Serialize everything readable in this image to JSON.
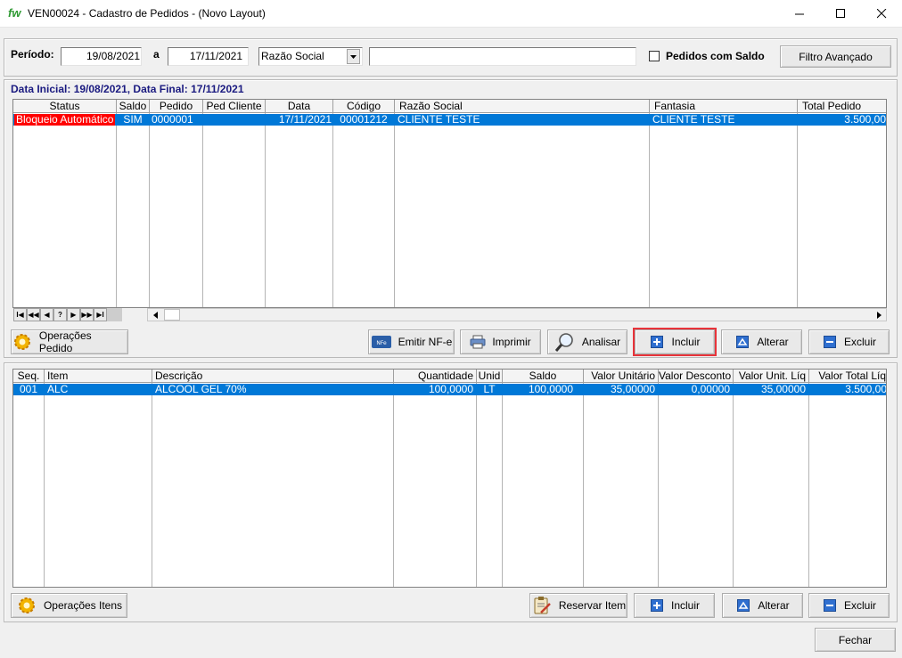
{
  "window": {
    "app_glyph": "fw",
    "title": "VEN00024 - Cadastro de Pedidos - (Novo Layout)",
    "minimize": "–",
    "maximize": "☐",
    "close": "✕"
  },
  "filter": {
    "periodo_label": "Período:",
    "date_start": "19/08/2021",
    "a_label": "a",
    "date_end": "17/11/2021",
    "field_select": "Razão Social",
    "search_value": "",
    "pedidos_saldo_label": "Pedidos com Saldo",
    "filtro_avancado": "Filtro Avançado"
  },
  "summary": "Data Inicial: 19/08/2021, Data Final: 17/11/2021",
  "orders_grid": {
    "columns": [
      "Status",
      "Saldo",
      "Pedido",
      "Ped Cliente",
      "Data",
      "Código",
      "Razão Social",
      "Fantasia",
      "Total Pedido"
    ],
    "rows": [
      [
        "Bloqueio Automático",
        "SIM",
        "0000001",
        "",
        "17/11/2021",
        "00001212",
        "CLIENTE TESTE",
        "CLIENTE TESTE",
        "3.500,00"
      ]
    ],
    "status_color": "#ff0000",
    "nav": [
      "I◀",
      "◀◀",
      "◀",
      "?",
      "▶",
      "▶▶",
      "▶I"
    ]
  },
  "order_actions": {
    "operacoes": "Operações Pedido",
    "emitir_nfe": "Emitir NF-e",
    "nfe_badge": "NFe",
    "imprimir": "Imprimir",
    "analisar": "Analisar",
    "incluir": "Incluir",
    "alterar": "Alterar",
    "excluir": "Excluir"
  },
  "items_grid": {
    "columns": [
      "Seq.",
      "Item",
      "Descrição",
      "Quantidade",
      "Unid",
      "Saldo",
      "Valor Unitário",
      "Valor Desconto",
      "Valor Unit. Líq",
      "Valor Total  Líq"
    ],
    "rows": [
      [
        "001",
        "ALC",
        "ALCOOL GEL 70%",
        "100,0000",
        "LT",
        "100,0000",
        "35,00000",
        "0,00000",
        "35,00000",
        "3.500,00"
      ]
    ]
  },
  "item_actions": {
    "operacoes": "Operações Itens",
    "reservar": "Reservar Item",
    "incluir": "Incluir",
    "alterar": "Alterar",
    "excluir": "Excluir"
  },
  "footer": {
    "fechar": "Fechar"
  },
  "colors": {
    "selection": "#0078d7",
    "highlight_border": "#e8333a",
    "summary_text": "#1a1a80"
  }
}
